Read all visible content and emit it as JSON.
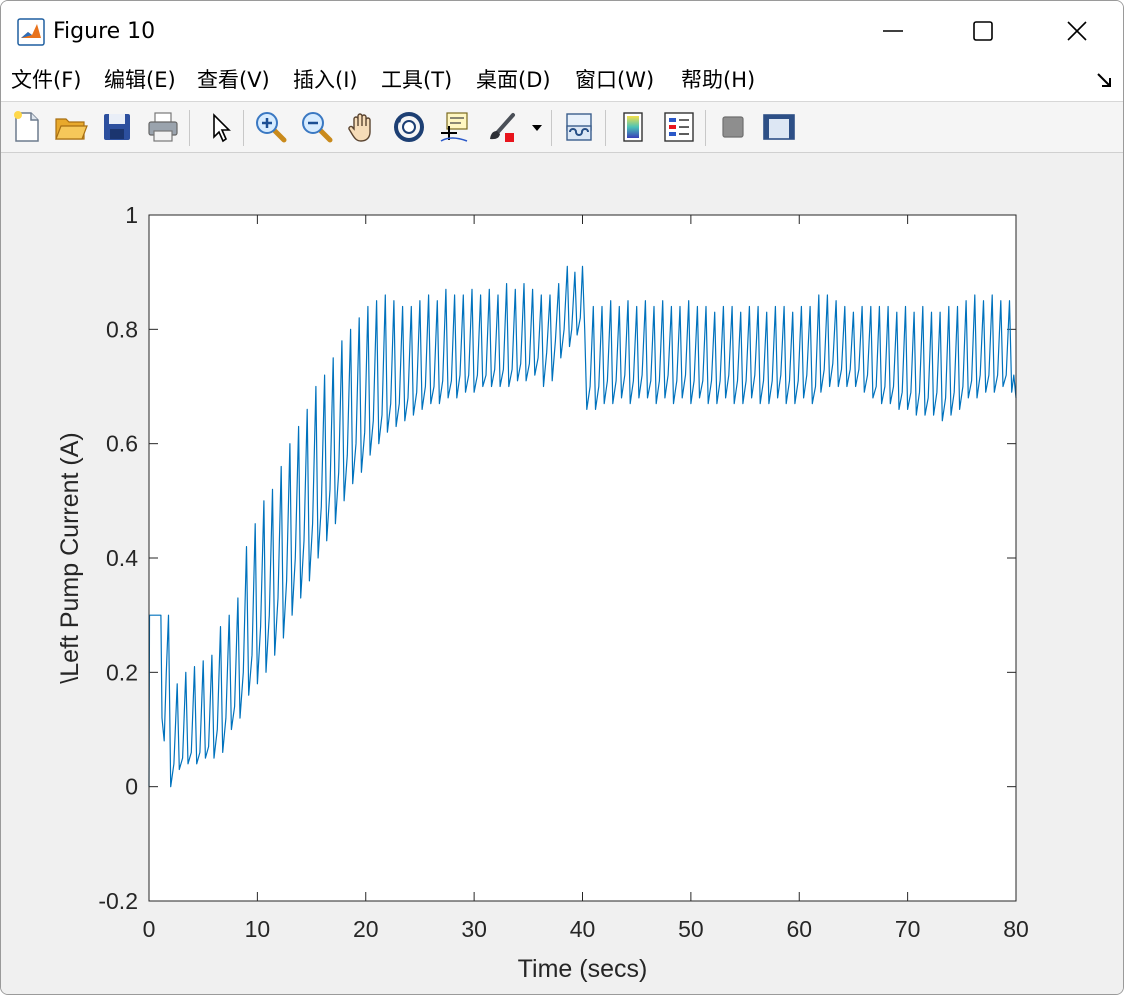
{
  "window": {
    "title": "Figure 10"
  },
  "menu": {
    "items": [
      "文件(F)",
      "编辑(E)",
      "查看(V)",
      "插入(I)",
      "工具(T)",
      "桌面(D)",
      "窗口(W)",
      "帮助(H)"
    ]
  },
  "toolbar": {
    "buttons": [
      "new-figure",
      "open-file",
      "save",
      "print",
      "edit-plot",
      "zoom-in",
      "zoom-out",
      "pan",
      "rotate-3d",
      "data-cursor",
      "brush",
      "link-plot",
      "colorbar",
      "legend",
      "hide-plot-tools",
      "show-plot-tools"
    ]
  },
  "colors": {
    "line": "#0072BD"
  },
  "chart_data": {
    "type": "line",
    "title": "",
    "xlabel": "Time (secs)",
    "ylabel": "\\Left Pump Current (A)",
    "xlim": [
      0,
      80
    ],
    "ylim": [
      -0.2,
      1
    ],
    "xticks": [
      "0",
      "10",
      "20",
      "30",
      "40",
      "50",
      "60",
      "70",
      "80"
    ],
    "yticks": [
      "-0.2",
      "0",
      "0.2",
      "0.4",
      "0.6",
      "0.8",
      "1"
    ],
    "grid": false,
    "series": [
      {
        "color": "#0072BD",
        "description": "oscillating pump current (~1.5 s period): starts at 0, steps to 0.3 for ~1 s, drops to ~0.05 with spikes to ~0.2, rises between 8 and 30 s, peaks ~0.91 near 39 s, then settles ~0.72 with spikes to ~0.85",
        "points": [
          [
            0,
            0.0
          ],
          [
            0.05,
            0.3
          ],
          [
            1.1,
            0.3
          ],
          [
            1.2,
            0.12
          ],
          [
            1.4,
            0.08
          ],
          [
            1.6,
            0.2
          ],
          [
            1.8,
            0.3
          ],
          [
            2.0,
            0.0
          ],
          [
            2.3,
            0.04
          ],
          [
            2.6,
            0.18
          ],
          [
            2.8,
            0.03
          ],
          [
            3.1,
            0.05
          ],
          [
            3.4,
            0.2
          ],
          [
            3.6,
            0.04
          ],
          [
            3.9,
            0.06
          ],
          [
            4.2,
            0.21
          ],
          [
            4.4,
            0.04
          ],
          [
            4.7,
            0.06
          ],
          [
            5.0,
            0.22
          ],
          [
            5.2,
            0.05
          ],
          [
            5.5,
            0.07
          ],
          [
            5.8,
            0.23
          ],
          [
            6.0,
            0.05
          ],
          [
            6.3,
            0.1
          ],
          [
            6.6,
            0.28
          ],
          [
            6.8,
            0.06
          ],
          [
            7.1,
            0.12
          ],
          [
            7.4,
            0.3
          ],
          [
            7.6,
            0.1
          ],
          [
            7.9,
            0.14
          ],
          [
            8.2,
            0.33
          ],
          [
            8.4,
            0.12
          ],
          [
            8.7,
            0.2
          ],
          [
            9.0,
            0.42
          ],
          [
            9.2,
            0.16
          ],
          [
            9.5,
            0.23
          ],
          [
            9.8,
            0.46
          ],
          [
            10.0,
            0.18
          ],
          [
            10.3,
            0.28
          ],
          [
            10.6,
            0.5
          ],
          [
            10.8,
            0.2
          ],
          [
            11.1,
            0.3
          ],
          [
            11.4,
            0.52
          ],
          [
            11.6,
            0.23
          ],
          [
            11.9,
            0.33
          ],
          [
            12.2,
            0.56
          ],
          [
            12.4,
            0.26
          ],
          [
            12.7,
            0.36
          ],
          [
            13.0,
            0.6
          ],
          [
            13.2,
            0.3
          ],
          [
            13.5,
            0.4
          ],
          [
            13.8,
            0.63
          ],
          [
            14.0,
            0.33
          ],
          [
            14.3,
            0.43
          ],
          [
            14.6,
            0.66
          ],
          [
            14.8,
            0.36
          ],
          [
            15.1,
            0.46
          ],
          [
            15.4,
            0.7
          ],
          [
            15.6,
            0.4
          ],
          [
            15.9,
            0.49
          ],
          [
            16.2,
            0.72
          ],
          [
            16.4,
            0.43
          ],
          [
            16.7,
            0.52
          ],
          [
            17.0,
            0.75
          ],
          [
            17.2,
            0.46
          ],
          [
            17.5,
            0.55
          ],
          [
            17.8,
            0.78
          ],
          [
            18.0,
            0.5
          ],
          [
            18.3,
            0.58
          ],
          [
            18.6,
            0.8
          ],
          [
            18.8,
            0.53
          ],
          [
            19.1,
            0.6
          ],
          [
            19.4,
            0.82
          ],
          [
            19.6,
            0.55
          ],
          [
            19.9,
            0.62
          ],
          [
            20.2,
            0.84
          ],
          [
            20.4,
            0.58
          ],
          [
            20.7,
            0.64
          ],
          [
            21.0,
            0.85
          ],
          [
            21.2,
            0.6
          ],
          [
            21.5,
            0.65
          ],
          [
            21.8,
            0.86
          ],
          [
            22.0,
            0.62
          ],
          [
            22.3,
            0.67
          ],
          [
            22.6,
            0.85
          ],
          [
            22.8,
            0.63
          ],
          [
            23.1,
            0.67
          ],
          [
            23.4,
            0.84
          ],
          [
            23.6,
            0.64
          ],
          [
            23.9,
            0.68
          ],
          [
            24.2,
            0.84
          ],
          [
            24.4,
            0.65
          ],
          [
            24.7,
            0.69
          ],
          [
            25.0,
            0.85
          ],
          [
            25.2,
            0.66
          ],
          [
            25.5,
            0.7
          ],
          [
            25.8,
            0.86
          ],
          [
            26.0,
            0.67
          ],
          [
            26.3,
            0.7
          ],
          [
            26.6,
            0.85
          ],
          [
            26.8,
            0.67
          ],
          [
            27.1,
            0.71
          ],
          [
            27.4,
            0.87
          ],
          [
            27.6,
            0.68
          ],
          [
            27.9,
            0.71
          ],
          [
            28.2,
            0.86
          ],
          [
            28.4,
            0.68
          ],
          [
            28.7,
            0.72
          ],
          [
            29.0,
            0.86
          ],
          [
            29.2,
            0.69
          ],
          [
            29.5,
            0.72
          ],
          [
            29.8,
            0.87
          ],
          [
            30.0,
            0.69
          ],
          [
            30.3,
            0.72
          ],
          [
            30.6,
            0.86
          ],
          [
            30.8,
            0.7
          ],
          [
            31.1,
            0.72
          ],
          [
            31.4,
            0.87
          ],
          [
            31.6,
            0.7
          ],
          [
            31.9,
            0.73
          ],
          [
            32.2,
            0.86
          ],
          [
            32.4,
            0.7
          ],
          [
            32.7,
            0.73
          ],
          [
            33.0,
            0.88
          ],
          [
            33.2,
            0.7
          ],
          [
            33.5,
            0.73
          ],
          [
            33.8,
            0.87
          ],
          [
            34.0,
            0.71
          ],
          [
            34.3,
            0.74
          ],
          [
            34.6,
            0.88
          ],
          [
            34.8,
            0.71
          ],
          [
            35.1,
            0.74
          ],
          [
            35.4,
            0.87
          ],
          [
            35.6,
            0.72
          ],
          [
            35.9,
            0.75
          ],
          [
            36.2,
            0.86
          ],
          [
            36.4,
            0.7
          ],
          [
            36.7,
            0.76
          ],
          [
            37.0,
            0.86
          ],
          [
            37.2,
            0.71
          ],
          [
            37.5,
            0.78
          ],
          [
            37.8,
            0.88
          ],
          [
            38.0,
            0.75
          ],
          [
            38.3,
            0.8
          ],
          [
            38.6,
            0.91
          ],
          [
            38.8,
            0.77
          ],
          [
            39.0,
            0.8
          ],
          [
            39.3,
            0.9
          ],
          [
            39.5,
            0.79
          ],
          [
            39.8,
            0.82
          ],
          [
            40.0,
            0.91
          ],
          [
            40.2,
            0.8
          ],
          [
            40.4,
            0.66
          ],
          [
            40.7,
            0.7
          ],
          [
            41.0,
            0.84
          ],
          [
            41.2,
            0.66
          ],
          [
            41.5,
            0.7
          ],
          [
            41.8,
            0.84
          ],
          [
            42.0,
            0.67
          ],
          [
            42.3,
            0.71
          ],
          [
            42.6,
            0.85
          ],
          [
            42.8,
            0.67
          ],
          [
            43.1,
            0.71
          ],
          [
            43.4,
            0.84
          ],
          [
            43.6,
            0.68
          ],
          [
            43.9,
            0.72
          ],
          [
            44.2,
            0.85
          ],
          [
            44.4,
            0.67
          ],
          [
            44.7,
            0.71
          ],
          [
            45.0,
            0.84
          ],
          [
            45.2,
            0.68
          ],
          [
            45.5,
            0.72
          ],
          [
            45.8,
            0.85
          ],
          [
            46.0,
            0.68
          ],
          [
            46.3,
            0.71
          ],
          [
            46.6,
            0.84
          ],
          [
            46.8,
            0.67
          ],
          [
            47.1,
            0.71
          ],
          [
            47.4,
            0.85
          ],
          [
            47.6,
            0.68
          ],
          [
            47.9,
            0.72
          ],
          [
            48.2,
            0.84
          ],
          [
            48.4,
            0.67
          ],
          [
            48.7,
            0.71
          ],
          [
            49.0,
            0.84
          ],
          [
            49.2,
            0.68
          ],
          [
            49.5,
            0.72
          ],
          [
            49.8,
            0.85
          ],
          [
            50.0,
            0.67
          ],
          [
            50.3,
            0.71
          ],
          [
            50.6,
            0.84
          ],
          [
            50.8,
            0.68
          ],
          [
            51.1,
            0.71
          ],
          [
            51.4,
            0.84
          ],
          [
            51.6,
            0.67
          ],
          [
            51.9,
            0.71
          ],
          [
            52.2,
            0.83
          ],
          [
            52.4,
            0.67
          ],
          [
            52.7,
            0.71
          ],
          [
            53.0,
            0.84
          ],
          [
            53.2,
            0.68
          ],
          [
            53.5,
            0.72
          ],
          [
            53.8,
            0.84
          ],
          [
            54.0,
            0.67
          ],
          [
            54.3,
            0.71
          ],
          [
            54.6,
            0.83
          ],
          [
            54.8,
            0.67
          ],
          [
            55.1,
            0.71
          ],
          [
            55.4,
            0.84
          ],
          [
            55.6,
            0.68
          ],
          [
            55.9,
            0.72
          ],
          [
            56.2,
            0.84
          ],
          [
            56.4,
            0.67
          ],
          [
            56.7,
            0.71
          ],
          [
            57.0,
            0.83
          ],
          [
            57.2,
            0.67
          ],
          [
            57.5,
            0.71
          ],
          [
            57.8,
            0.84
          ],
          [
            58.0,
            0.68
          ],
          [
            58.3,
            0.72
          ],
          [
            58.6,
            0.84
          ],
          [
            58.8,
            0.67
          ],
          [
            59.1,
            0.71
          ],
          [
            59.4,
            0.83
          ],
          [
            59.6,
            0.67
          ],
          [
            59.9,
            0.71
          ],
          [
            60.2,
            0.84
          ],
          [
            60.4,
            0.68
          ],
          [
            60.7,
            0.72
          ],
          [
            61.0,
            0.84
          ],
          [
            61.2,
            0.67
          ],
          [
            61.5,
            0.7
          ],
          [
            61.8,
            0.86
          ],
          [
            62.0,
            0.69
          ],
          [
            62.3,
            0.73
          ],
          [
            62.6,
            0.86
          ],
          [
            62.8,
            0.7
          ],
          [
            63.1,
            0.74
          ],
          [
            63.4,
            0.85
          ],
          [
            63.6,
            0.7
          ],
          [
            63.9,
            0.73
          ],
          [
            64.2,
            0.84
          ],
          [
            64.4,
            0.7
          ],
          [
            64.7,
            0.73
          ],
          [
            65.0,
            0.83
          ],
          [
            65.2,
            0.7
          ],
          [
            65.5,
            0.73
          ],
          [
            65.8,
            0.84
          ],
          [
            66.0,
            0.69
          ],
          [
            66.3,
            0.72
          ],
          [
            66.6,
            0.84
          ],
          [
            66.8,
            0.68
          ],
          [
            67.1,
            0.7
          ],
          [
            67.4,
            0.84
          ],
          [
            67.6,
            0.67
          ],
          [
            67.9,
            0.7
          ],
          [
            68.2,
            0.84
          ],
          [
            68.4,
            0.67
          ],
          [
            68.7,
            0.7
          ],
          [
            69.0,
            0.83
          ],
          [
            69.2,
            0.66
          ],
          [
            69.5,
            0.69
          ],
          [
            69.8,
            0.84
          ],
          [
            70.0,
            0.66
          ],
          [
            70.3,
            0.69
          ],
          [
            70.6,
            0.83
          ],
          [
            70.8,
            0.65
          ],
          [
            71.1,
            0.69
          ],
          [
            71.4,
            0.84
          ],
          [
            71.6,
            0.65
          ],
          [
            71.9,
            0.68
          ],
          [
            72.2,
            0.83
          ],
          [
            72.4,
            0.65
          ],
          [
            72.7,
            0.69
          ],
          [
            73.0,
            0.83
          ],
          [
            73.2,
            0.64
          ],
          [
            73.5,
            0.68
          ],
          [
            73.8,
            0.84
          ],
          [
            74.0,
            0.65
          ],
          [
            74.3,
            0.69
          ],
          [
            74.6,
            0.84
          ],
          [
            74.8,
            0.66
          ],
          [
            75.1,
            0.7
          ],
          [
            75.4,
            0.85
          ],
          [
            75.6,
            0.68
          ],
          [
            75.9,
            0.71
          ],
          [
            76.2,
            0.86
          ],
          [
            76.4,
            0.68
          ],
          [
            76.7,
            0.72
          ],
          [
            77.0,
            0.85
          ],
          [
            77.2,
            0.69
          ],
          [
            77.5,
            0.72
          ],
          [
            77.8,
            0.86
          ],
          [
            78.0,
            0.69
          ],
          [
            78.3,
            0.72
          ],
          [
            78.6,
            0.85
          ],
          [
            78.8,
            0.7
          ],
          [
            79.1,
            0.72
          ],
          [
            79.4,
            0.85
          ],
          [
            79.6,
            0.69
          ],
          [
            79.8,
            0.72
          ],
          [
            80.0,
            0.68
          ]
        ]
      }
    ]
  }
}
